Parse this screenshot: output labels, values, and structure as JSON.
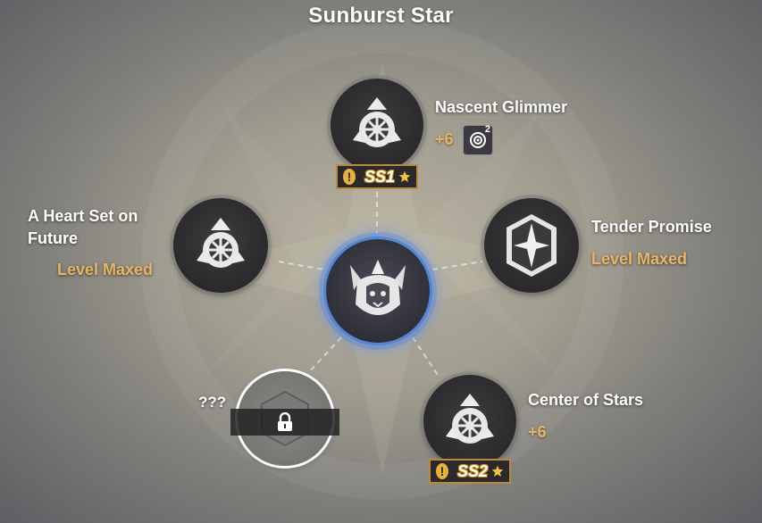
{
  "title": "Sunburst Star",
  "nodes": {
    "nascent": {
      "name": "Nascent Glimmer",
      "bonus": "+6",
      "item_count": "2",
      "badge": "SS1",
      "icon": "gear-emblem-icon"
    },
    "heart": {
      "name_line1": "A Heart Set on",
      "name_line2": "Future",
      "status": "Level Maxed",
      "icon": "gear-emblem-icon"
    },
    "tender": {
      "name": "Tender Promise",
      "status": "Level Maxed",
      "icon": "crystal-star-icon"
    },
    "center": {
      "icon": "lion-crest-icon"
    },
    "locked": {
      "name": "???",
      "icon": "lock-icon"
    },
    "stars": {
      "name": "Center of Stars",
      "bonus": "+6",
      "badge": "SS2",
      "icon": "gear-emblem-icon"
    }
  },
  "colors": {
    "gold": "#e8b560",
    "glow": "#4f86d8",
    "badge_border": "#b88a3a"
  }
}
